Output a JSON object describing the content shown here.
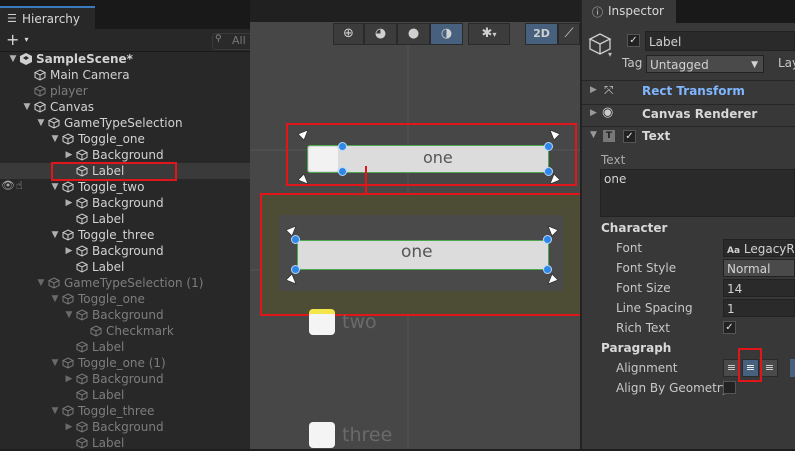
{
  "hierarchy": {
    "tab_label": "Hierarchy",
    "add_label": "+",
    "search_text": "All",
    "items": [
      {
        "label": "SampleScene*",
        "depth": 0,
        "expanded": true,
        "dim": false,
        "type": "scene"
      },
      {
        "label": "Main Camera",
        "depth": 1,
        "expanded": null,
        "dim": false,
        "type": "obj"
      },
      {
        "label": "player",
        "depth": 1,
        "expanded": null,
        "dim": true,
        "type": "obj"
      },
      {
        "label": "Canvas",
        "depth": 1,
        "expanded": true,
        "dim": false,
        "type": "obj"
      },
      {
        "label": "GameTypeSelection",
        "depth": 2,
        "expanded": true,
        "dim": false,
        "type": "obj"
      },
      {
        "label": "Toggle_one",
        "depth": 3,
        "expanded": true,
        "dim": false,
        "type": "obj"
      },
      {
        "label": "Background",
        "depth": 4,
        "expanded": false,
        "dim": false,
        "type": "obj"
      },
      {
        "label": "Label",
        "depth": 4,
        "expanded": null,
        "dim": false,
        "type": "obj",
        "selected": true
      },
      {
        "label": "Toggle_two",
        "depth": 3,
        "expanded": true,
        "dim": false,
        "type": "obj"
      },
      {
        "label": "Background",
        "depth": 4,
        "expanded": false,
        "dim": false,
        "type": "obj"
      },
      {
        "label": "Label",
        "depth": 4,
        "expanded": null,
        "dim": false,
        "type": "obj"
      },
      {
        "label": "Toggle_three",
        "depth": 3,
        "expanded": true,
        "dim": false,
        "type": "obj"
      },
      {
        "label": "Background",
        "depth": 4,
        "expanded": false,
        "dim": false,
        "type": "obj"
      },
      {
        "label": "Label",
        "depth": 4,
        "expanded": null,
        "dim": false,
        "type": "obj"
      },
      {
        "label": "GameTypeSelection (1)",
        "depth": 2,
        "expanded": true,
        "dim": true,
        "type": "obj"
      },
      {
        "label": "Toggle_one",
        "depth": 3,
        "expanded": true,
        "dim": true,
        "type": "obj"
      },
      {
        "label": "Background",
        "depth": 4,
        "expanded": true,
        "dim": true,
        "type": "obj"
      },
      {
        "label": "Checkmark",
        "depth": 5,
        "expanded": null,
        "dim": true,
        "type": "obj"
      },
      {
        "label": "Label",
        "depth": 4,
        "expanded": null,
        "dim": true,
        "type": "obj"
      },
      {
        "label": "Toggle_one (1)",
        "depth": 3,
        "expanded": true,
        "dim": true,
        "type": "obj"
      },
      {
        "label": "Background",
        "depth": 4,
        "expanded": false,
        "dim": true,
        "type": "obj"
      },
      {
        "label": "Label",
        "depth": 4,
        "expanded": null,
        "dim": true,
        "type": "obj"
      },
      {
        "label": "Toggle_three",
        "depth": 3,
        "expanded": true,
        "dim": true,
        "type": "obj"
      },
      {
        "label": "Background",
        "depth": 4,
        "expanded": false,
        "dim": true,
        "type": "obj"
      },
      {
        "label": "Label",
        "depth": 4,
        "expanded": null,
        "dim": true,
        "type": "obj"
      }
    ]
  },
  "scene": {
    "toolbar": {
      "mode_2d": "2D"
    },
    "toggle_one_text": "one",
    "toggle_one_text_zoomed": "one",
    "toggle_two_text": "two",
    "toggle_three_text": "three"
  },
  "inspector": {
    "tab_label": "Inspector",
    "object_name": "Label",
    "tag_label": "Tag",
    "tag_value": "Untagged",
    "layer_label": "Lay",
    "components": [
      "Rect Transform",
      "Canvas Renderer",
      "Text"
    ],
    "text_section_label": "Text",
    "text_value": "one",
    "character_header": "Character",
    "font_label": "Font",
    "font_value": "LegacyRu",
    "font_style_label": "Font Style",
    "font_style_value": "Normal",
    "font_size_label": "Font Size",
    "font_size_value": "14",
    "line_spacing_label": "Line Spacing",
    "line_spacing_value": "1",
    "rich_text_label": "Rich Text",
    "paragraph_header": "Paragraph",
    "alignment_label": "Alignment",
    "align_geometry_label": "Align By Geometry",
    "font_field_prefix": "Aa"
  },
  "colors": {
    "accent": "#2f88e6",
    "selection": "#2c5d87",
    "annotation": "#e0161b",
    "rect_transform_label": "#7fb6ff"
  }
}
